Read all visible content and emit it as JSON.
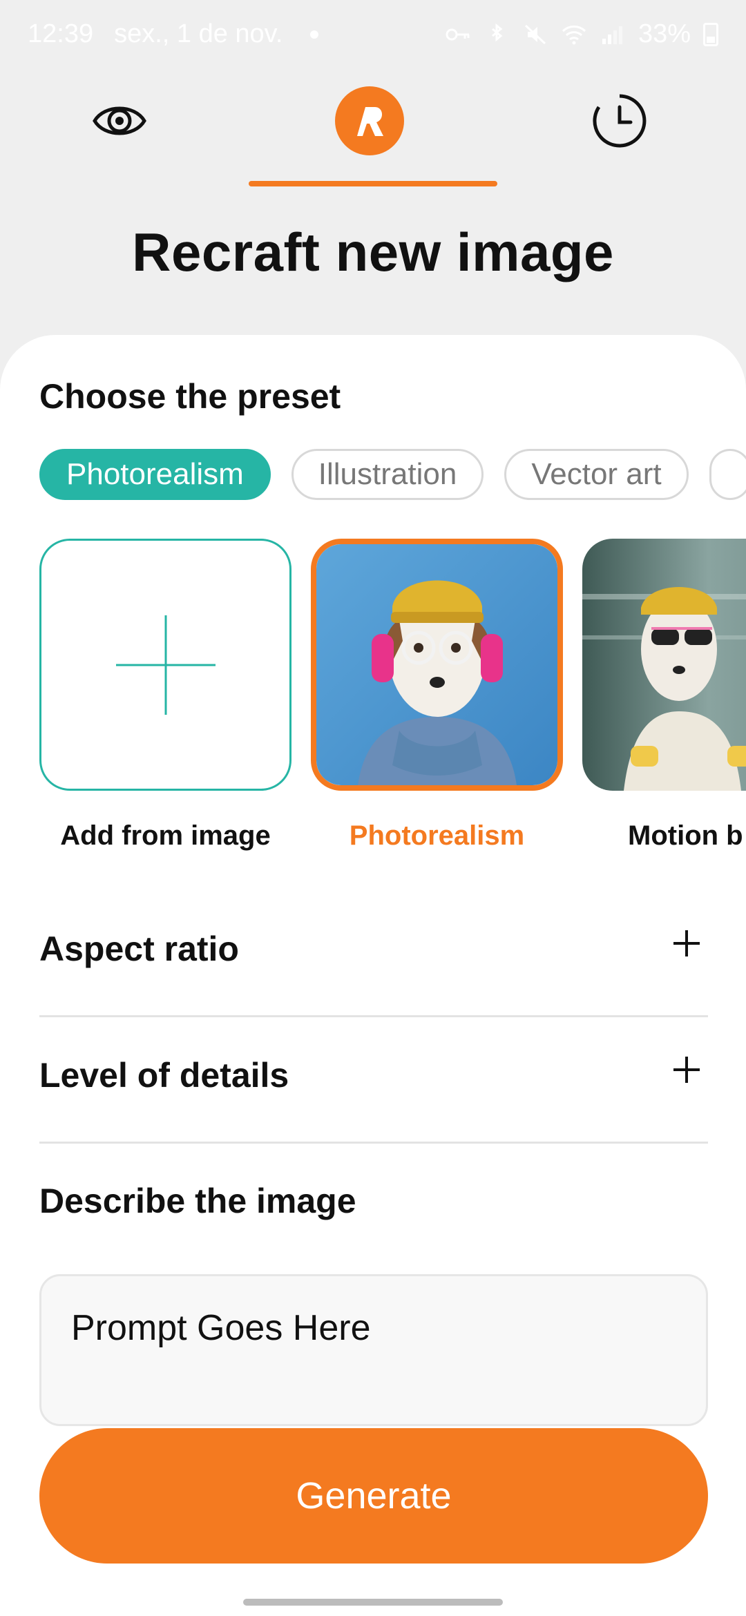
{
  "status_bar": {
    "time": "12:39",
    "date": "sex., 1 de nov.",
    "battery": "33%"
  },
  "nav": {
    "items": [
      {
        "icon": "eye-icon",
        "active": false
      },
      {
        "icon": "recraft-logo-icon",
        "active": true,
        "logo_letter": "R"
      },
      {
        "icon": "history-clock-icon",
        "active": false
      }
    ],
    "accent": "#f47a20"
  },
  "title": "Recraft new image",
  "preset": {
    "heading": "Choose the preset",
    "chips": [
      {
        "label": "Photorealism",
        "active": true
      },
      {
        "label": "Illustration",
        "active": false
      },
      {
        "label": "Vector art",
        "active": false
      }
    ],
    "tiles": [
      {
        "label": "Add from image",
        "icon": "plus-icon"
      },
      {
        "label": "Photorealism",
        "selected": true
      },
      {
        "label": "Motion b"
      }
    ]
  },
  "aspect_ratio": {
    "title": "Aspect ratio",
    "icon": "plus-icon"
  },
  "level_of_details": {
    "title": "Level of details",
    "icon": "plus-icon"
  },
  "describe": {
    "heading": "Describe the image",
    "value": "Prompt Goes Here"
  },
  "generate_label": "Generate",
  "colors": {
    "teal": "#26b5a5",
    "orange": "#f47a20"
  }
}
